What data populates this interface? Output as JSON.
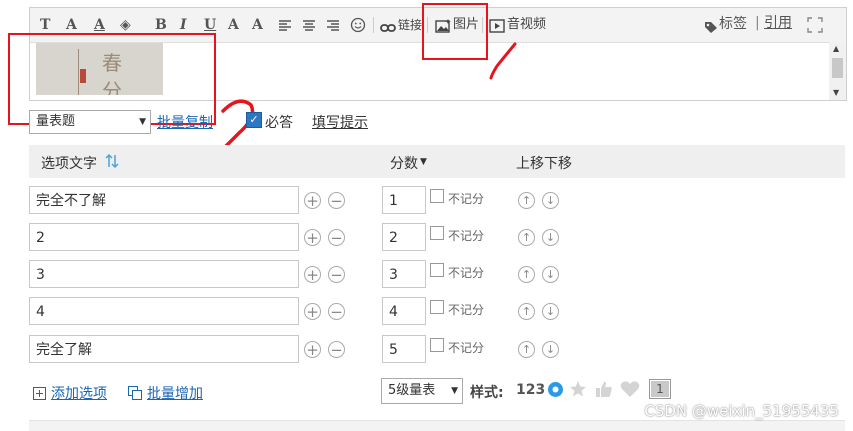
{
  "toolbar": {
    "format_icons": [
      "T",
      "A",
      "A",
      "◈",
      "B",
      "I",
      "U",
      "A",
      "A"
    ],
    "link_label": "链接",
    "image_label": "图片",
    "media_label": "音视频",
    "tag_label": "标签",
    "quote_label": "引用"
  },
  "editor": {
    "image_chars": [
      "春",
      "分"
    ]
  },
  "annotations": {
    "marker_1": "1",
    "marker_2": "2",
    "color": "#e8141c"
  },
  "question": {
    "type_value": "量表题",
    "batch_copy_label": "批量复制",
    "required_label": "必答",
    "hint_label": "填写提示"
  },
  "columns": {
    "option_text": "选项文字",
    "score": "分数",
    "move": "上移下移"
  },
  "options": [
    {
      "text": "完全不了解",
      "score": "1",
      "no_count": "不记分"
    },
    {
      "text": "2",
      "score": "2",
      "no_count": "不记分"
    },
    {
      "text": "3",
      "score": "3",
      "no_count": "不记分"
    },
    {
      "text": "4",
      "score": "4",
      "no_count": "不记分"
    },
    {
      "text": "完全了解",
      "score": "5",
      "no_count": "不记分"
    }
  ],
  "footer": {
    "add_option_label": "添加选项",
    "batch_add_label": "批量增加",
    "level_value": "5级量表",
    "style_label": "样式:",
    "style_numeric": "123",
    "style_box": "1"
  },
  "watermark": "CSDN @weixin_51955435",
  "colors": {
    "link": "#1a66b3",
    "accent": "#2a78c4",
    "sort_icon": "#4aa3e0"
  }
}
